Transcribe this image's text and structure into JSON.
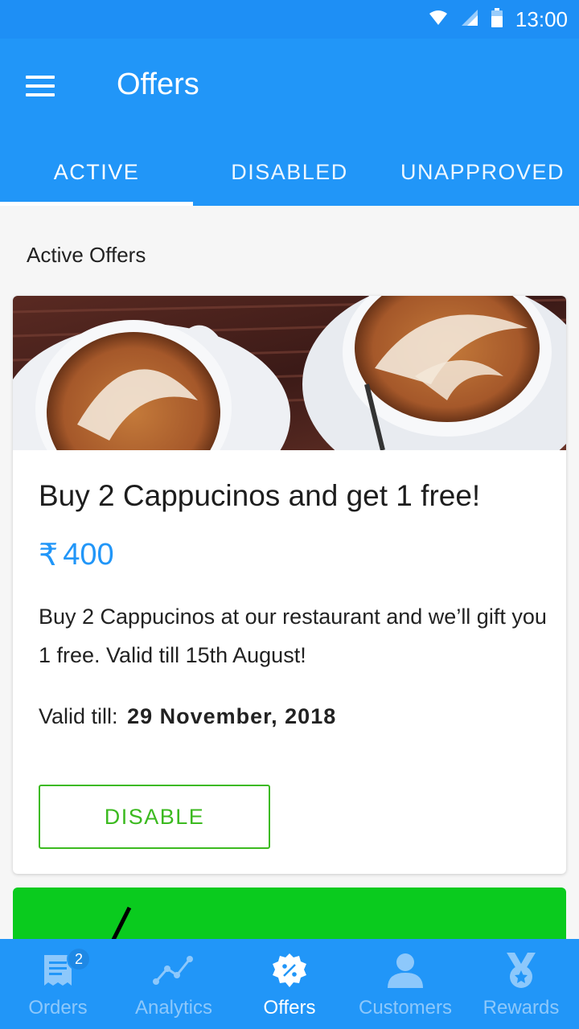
{
  "status_bar": {
    "time": "13:00",
    "icons": [
      "wifi-icon",
      "signal-icon",
      "battery-icon"
    ]
  },
  "app_bar": {
    "title": "Offers",
    "menu_icon": "menu-icon"
  },
  "tabs": [
    {
      "label": "ACTIVE",
      "selected": true
    },
    {
      "label": "DISABLED",
      "selected": false
    },
    {
      "label": "UNAPPROVED",
      "selected": false
    }
  ],
  "content": {
    "section_title": "Active Offers",
    "offer": {
      "title": "Buy 2 Cappucinos and get 1 free!",
      "currency_symbol": "₹",
      "price": "400",
      "description": "Buy 2 Cappucinos at our restaurant and we’ll gift you 1 free. Valid till 15th August!",
      "valid_label": "Valid till:",
      "valid_date": "29 November, 2018",
      "disable_label": "DISABLE"
    }
  },
  "bottom_nav": [
    {
      "label": "Orders",
      "icon": "receipt-icon",
      "badge": "2",
      "selected": false
    },
    {
      "label": "Analytics",
      "icon": "analytics-icon",
      "selected": false
    },
    {
      "label": "Offers",
      "icon": "percent-badge-icon",
      "selected": true
    },
    {
      "label": "Customers",
      "icon": "person-icon",
      "selected": false
    },
    {
      "label": "Rewards",
      "icon": "medal-icon",
      "selected": false
    }
  ],
  "colors": {
    "primary": "#2196f8",
    "status_bar": "#1e8ff5",
    "accent_green": "#3cba20",
    "peek_card_green": "#0acb1e",
    "nav_inactive": "#8dc8fb"
  }
}
